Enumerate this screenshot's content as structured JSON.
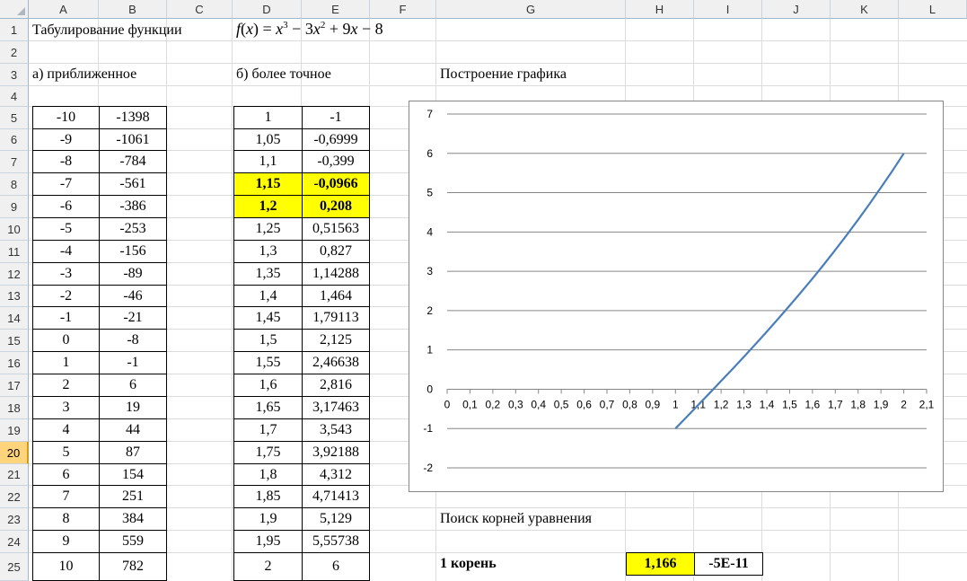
{
  "columns": [
    "A",
    "B",
    "C",
    "D",
    "E",
    "F",
    "G",
    "H",
    "I",
    "J",
    "K",
    "L"
  ],
  "rows": [
    "1",
    "2",
    "3",
    "4",
    "5",
    "6",
    "7",
    "8",
    "9",
    "10",
    "11",
    "12",
    "13",
    "14",
    "15",
    "16",
    "17",
    "18",
    "19",
    "20",
    "21",
    "22",
    "23",
    "24",
    "25"
  ],
  "selected_row": "20",
  "cells": {
    "title": "Табулирование функции",
    "formula": "f(x) = x3 − 3x2 + 9x − 8",
    "approx_header": "а) приближенное",
    "precise_header": "б) более точное",
    "chart_header": "Построение графика",
    "roots_header": "Поиск корней уравнения",
    "root_label": "1 корень",
    "root_value": "1,166",
    "root_residual": "-5E-11"
  },
  "formula_parts": {
    "f": "f",
    "lp": "(",
    "x": "x",
    "rp": ") = ",
    "x1": "x",
    "e1": "3",
    "m1": " − 3",
    "x2": "x",
    "e2": "2",
    "p1": " + 9",
    "x3": "x",
    "m2": " − 8"
  },
  "approx_table": [
    [
      "-10",
      "-1398"
    ],
    [
      "-9",
      "-1061"
    ],
    [
      "-8",
      "-784"
    ],
    [
      "-7",
      "-561"
    ],
    [
      "-6",
      "-386"
    ],
    [
      "-5",
      "-253"
    ],
    [
      "-4",
      "-156"
    ],
    [
      "-3",
      "-89"
    ],
    [
      "-2",
      "-46"
    ],
    [
      "-1",
      "-21"
    ],
    [
      "0",
      "-8"
    ],
    [
      "1",
      "-1"
    ],
    [
      "2",
      "6"
    ],
    [
      "3",
      "19"
    ],
    [
      "4",
      "44"
    ],
    [
      "5",
      "87"
    ],
    [
      "6",
      "154"
    ],
    [
      "7",
      "251"
    ],
    [
      "8",
      "384"
    ],
    [
      "9",
      "559"
    ],
    [
      "10",
      "782"
    ]
  ],
  "precise_table": [
    [
      "1",
      "-1"
    ],
    [
      "1,05",
      "-0,6999"
    ],
    [
      "1,1",
      "-0,399"
    ],
    [
      "1,15",
      "-0,0966"
    ],
    [
      "1,2",
      "0,208"
    ],
    [
      "1,25",
      "0,51563"
    ],
    [
      "1,3",
      "0,827"
    ],
    [
      "1,35",
      "1,14288"
    ],
    [
      "1,4",
      "1,464"
    ],
    [
      "1,45",
      "1,79113"
    ],
    [
      "1,5",
      "2,125"
    ],
    [
      "1,55",
      "2,46638"
    ],
    [
      "1,6",
      "2,816"
    ],
    [
      "1,65",
      "3,17463"
    ],
    [
      "1,7",
      "3,543"
    ],
    [
      "1,75",
      "3,92188"
    ],
    [
      "1,8",
      "4,312"
    ],
    [
      "1,85",
      "4,71413"
    ],
    [
      "1,9",
      "5,129"
    ],
    [
      "1,95",
      "5,55738"
    ],
    [
      "2",
      "6"
    ]
  ],
  "highlight_rows": [
    3,
    4
  ],
  "colors": {
    "highlight": "#ffff00",
    "series": "#4a7ebb",
    "gridline": "#868686",
    "header_bg": "#f0f0f0",
    "selected_header": "#ffd47a"
  },
  "chart_data": {
    "type": "line",
    "title": "",
    "xlabel": "",
    "ylabel": "",
    "x": [
      1,
      1.05,
      1.1,
      1.15,
      1.2,
      1.25,
      1.3,
      1.35,
      1.4,
      1.45,
      1.5,
      1.55,
      1.6,
      1.65,
      1.7,
      1.75,
      1.8,
      1.85,
      1.9,
      1.95,
      2
    ],
    "series": [
      {
        "values": [
          -1,
          -0.6999,
          -0.399,
          -0.0966,
          0.208,
          0.51563,
          0.827,
          1.14288,
          1.464,
          1.79113,
          2.125,
          2.46638,
          2.816,
          3.17463,
          3.543,
          3.92188,
          4.312,
          4.71413,
          5.129,
          5.55738,
          6
        ]
      }
    ],
    "xlim": [
      0,
      2.1
    ],
    "ylim": [
      -2,
      7
    ],
    "x_ticks": [
      "0",
      "0,1",
      "0,2",
      "0,3",
      "0,4",
      "0,5",
      "0,6",
      "0,7",
      "0,8",
      "0,9",
      "1",
      "1,1",
      "1,2",
      "1,3",
      "1,4",
      "1,5",
      "1,6",
      "1,7",
      "1,8",
      "1,9",
      "2",
      "2,1"
    ],
    "y_ticks": [
      "-2",
      "-1",
      "0",
      "1",
      "2",
      "3",
      "4",
      "5",
      "6",
      "7"
    ],
    "grid": true,
    "legend": "none"
  }
}
